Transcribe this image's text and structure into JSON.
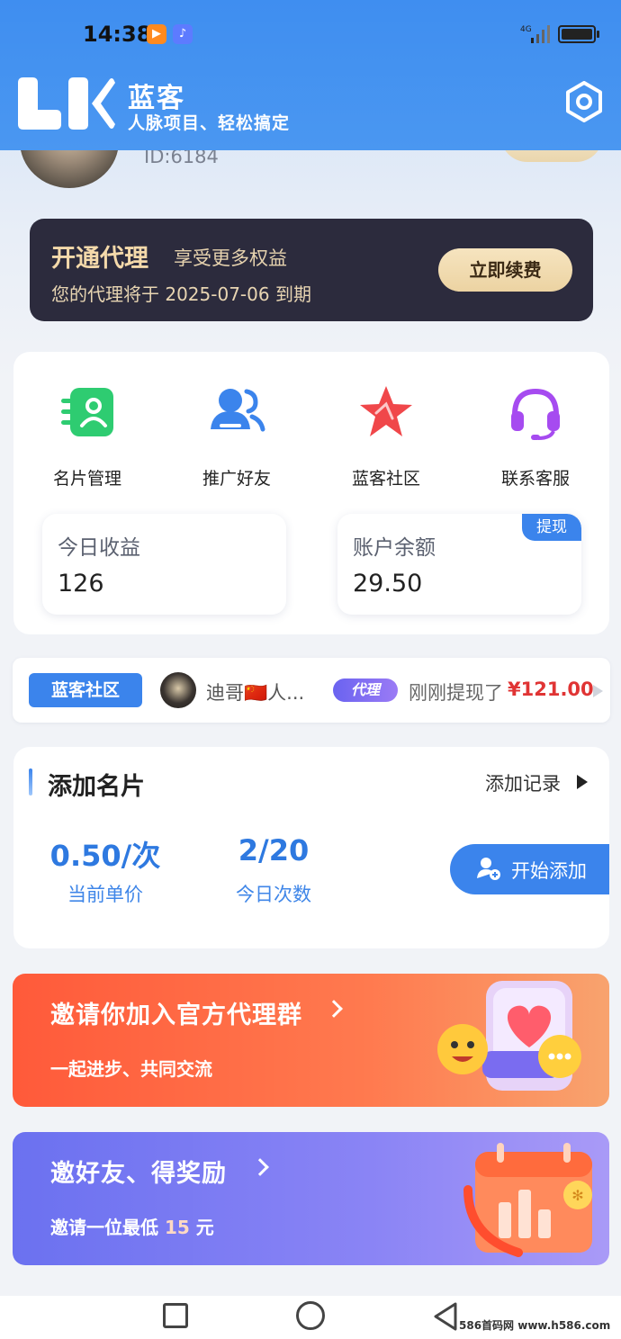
{
  "status_bar": {
    "time": "14:38",
    "signal_label": "4G"
  },
  "header": {
    "brand_name": "蓝客",
    "slogan": "人脉项目、轻松搞定",
    "logo_icon": "lk-logo-icon",
    "settings_icon": "gear-icon"
  },
  "profile": {
    "user_id": "ID:6184"
  },
  "agent_banner": {
    "title": "开通代理",
    "subtitle": "享受更多权益",
    "expire_text": "您的代理将于 2025-07-06 到期",
    "renew_label": "立即续费"
  },
  "features": [
    {
      "label": "名片管理",
      "icon": "card-manage-icon",
      "color": "#2ecc71"
    },
    {
      "label": "推广好友",
      "icon": "promote-friends-icon",
      "color": "#3b84ec"
    },
    {
      "label": "蓝客社区",
      "icon": "community-star-icon",
      "color": "#f0474a"
    },
    {
      "label": "联系客服",
      "icon": "headset-icon",
      "color": "#a64bf0"
    }
  ],
  "stats": {
    "today_income_label": "今日收益",
    "today_income_value": "126",
    "balance_label": "账户余额",
    "balance_value": "29.50",
    "withdraw_label": "提现"
  },
  "ticker": {
    "tag": "蓝客社区",
    "user_name": "迪哥🇨🇳人...",
    "role": "代理",
    "message": "刚刚提现了",
    "amount": "¥121.00"
  },
  "add_card": {
    "title": "添加名片",
    "record_label": "添加记录",
    "unit_price_value": "0.50/次",
    "unit_price_label": "当前单价",
    "count_value": "2/20",
    "count_label": "今日次数",
    "start_label": "开始添加"
  },
  "promos": {
    "group_title": "邀请你加入官方代理群",
    "group_sub": "一起进步、共同交流",
    "invite_title": "邀好友、得奖励",
    "invite_sub_prefix": "邀请一位最低",
    "invite_sub_amount": "15",
    "invite_sub_suffix": "元"
  },
  "watermark": "586首码网 www.h586.com",
  "colors": {
    "accent": "#3b84ec",
    "agent_bg": "#2c2b3d",
    "gold": "#f4d9aa",
    "price_red": "#e03434",
    "promo_orange": "#ff5a3a",
    "promo_purple": "#6b71f0"
  }
}
